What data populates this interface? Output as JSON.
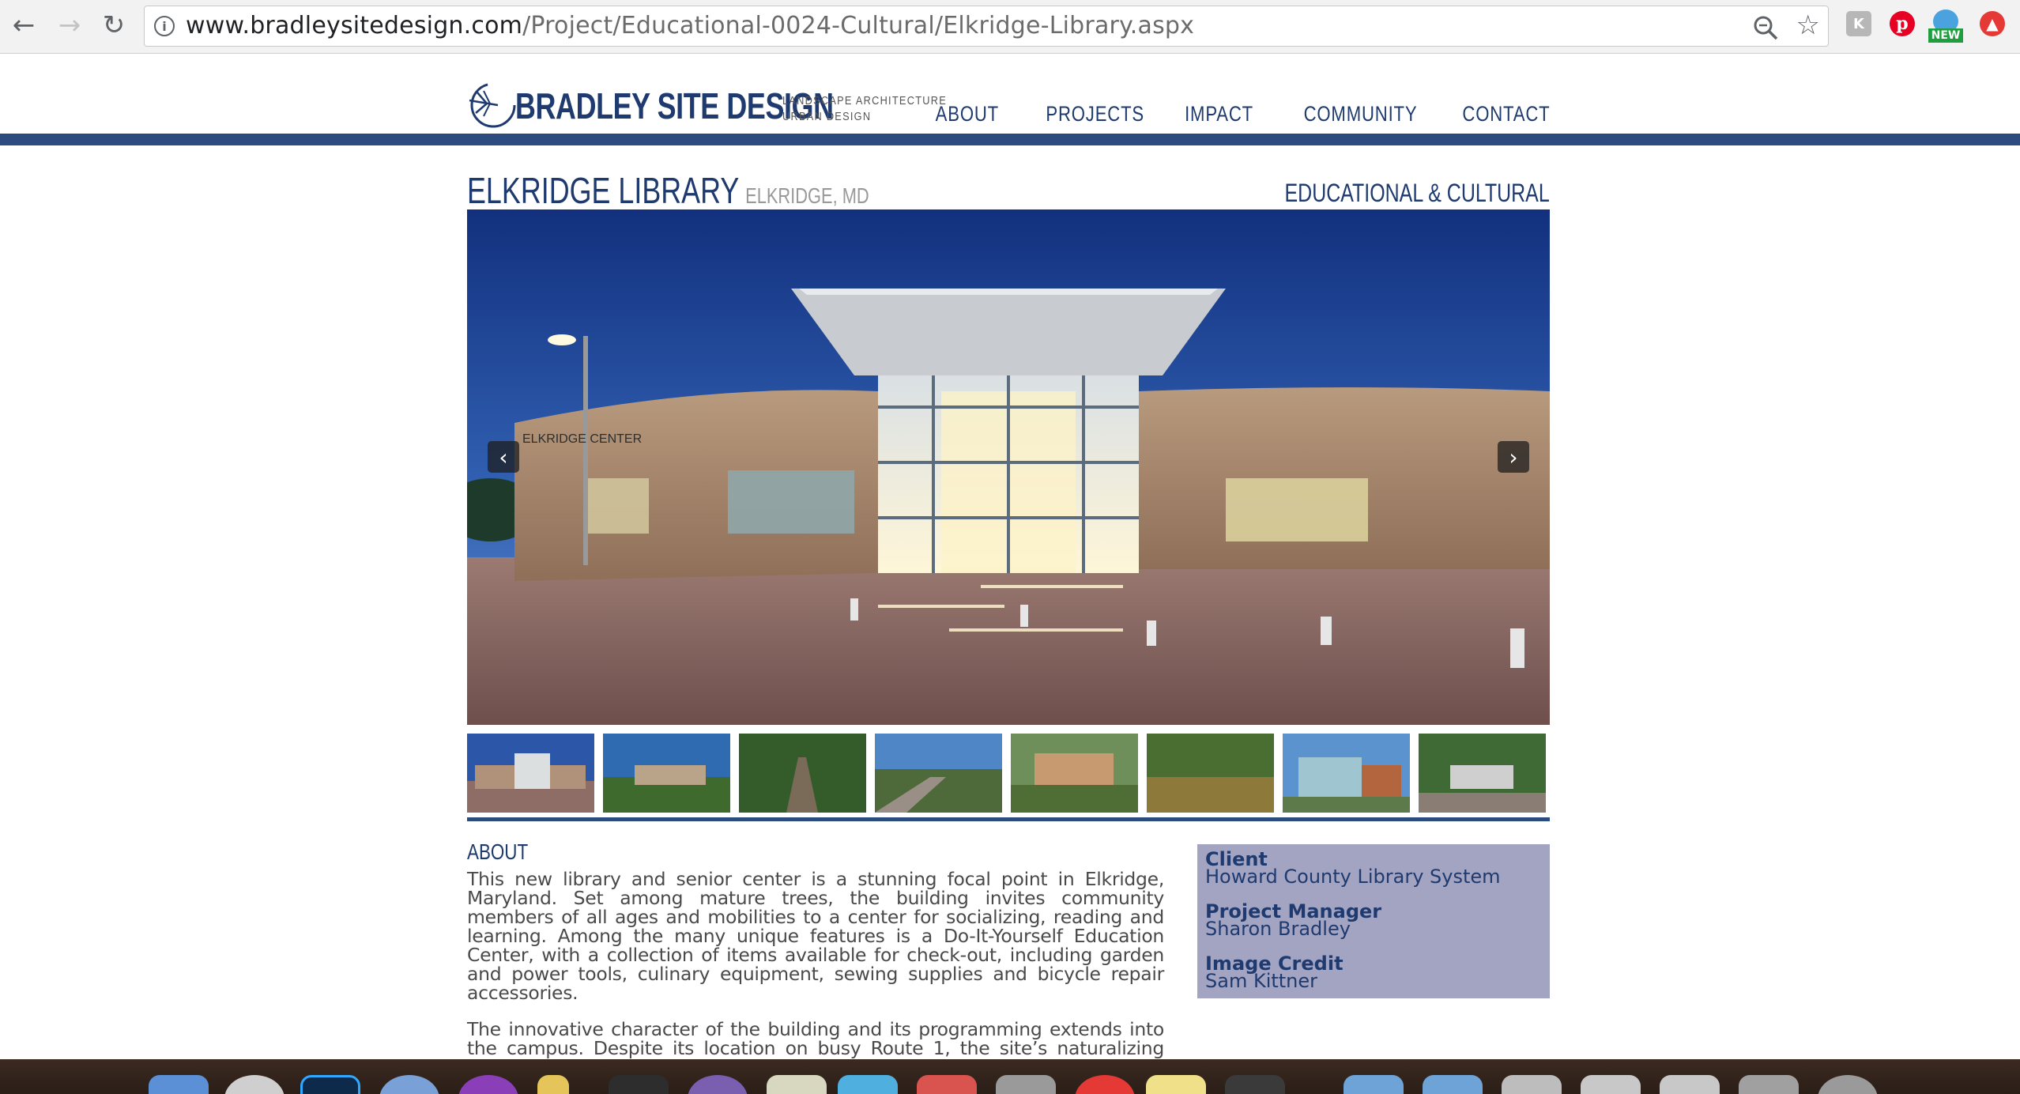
{
  "browser": {
    "url_host": "www.bradleysitedesign.com",
    "url_path": "/Project/Educational-0024-Cultural/Elkridge-Library.aspx",
    "ext_new_badge": "NEW"
  },
  "site": {
    "logo_name": "BRADLEY SITE DESIGN",
    "logo_tag_1": "LANDSCAPE ARCHITECTURE",
    "logo_tag_2": "URBAN DESIGN",
    "nav": [
      "ABOUT",
      "PROJECTS",
      "IMPACT",
      "COMMUNITY",
      "CONTACT"
    ],
    "brand_color": "#1f3a6e",
    "bar_color": "#2c4b7e"
  },
  "project": {
    "title": "ELKRIDGE LIBRARY",
    "location": "ELKRIDGE, MD",
    "category": "EDUCATIONAL & CULTURAL",
    "hero_sign_text": "ELKRIDGE CENTER",
    "about_heading": "ABOUT",
    "about_p1": "This new library and senior center is a stunning focal point in Elkridge, Maryland. Set among mature trees, the building invites community members of all ages and mobilities to a center for socializing, reading and learning. Among the many unique features is a Do-It-Yourself Education Center, with a collection of items available for check-out, including garden and power tools, culinary equipment, sewing supplies and bicycle repair accessories.",
    "about_p2": "The innovative character of the building and its programming extends into the campus. Despite its location on busy Route 1, the site’s naturalizing elements offered an opportunity to create an oasis among native plants and trees. A",
    "info": {
      "client_label": "Client",
      "client_value": "Howard County Library System",
      "pm_label": "Project Manager",
      "pm_value": "Sharon Bradley",
      "credit_label": "Image Credit",
      "credit_value": "Sam Kittner"
    },
    "thumbnail_count": 8
  }
}
